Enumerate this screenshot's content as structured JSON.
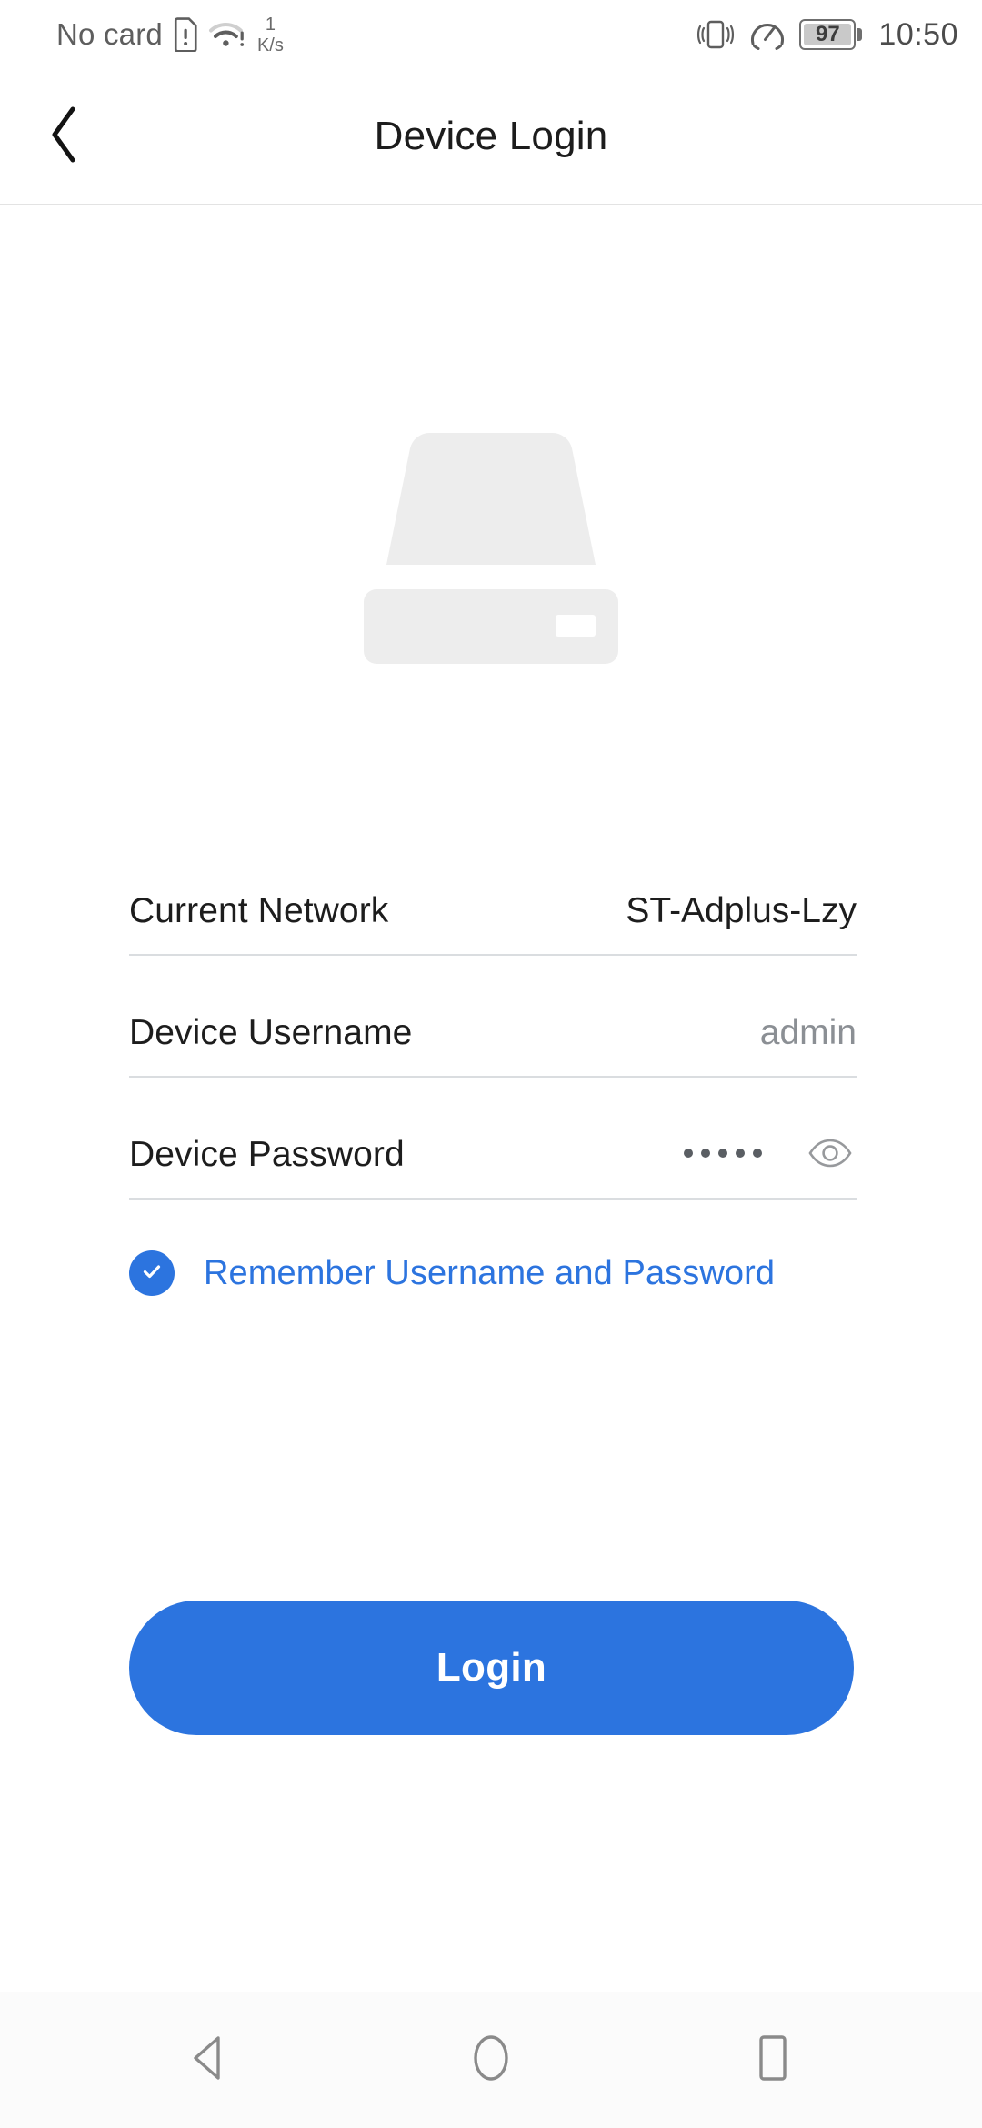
{
  "status_bar": {
    "carrier_text": "No card",
    "sim_icon": "sim-card-alert-icon",
    "wifi_icon": "wifi-warning-icon",
    "network_speed_value": "1",
    "network_speed_unit": "K/s",
    "vibrate_icon": "vibrate-icon",
    "data_saver_icon": "speedometer-icon",
    "battery_level": "97",
    "battery_icon": "battery-icon",
    "time": "10:50"
  },
  "app_bar": {
    "back_icon": "chevron-left-icon",
    "title": "Device Login"
  },
  "illustration": {
    "icon": "network-device-icon",
    "body_color": "#ededed",
    "led_color": "#ffffff"
  },
  "form": {
    "fields": [
      {
        "label": "Current Network",
        "value": "ST-Adplus-Lzy",
        "muted": false,
        "type": "readonly"
      },
      {
        "label": "Device Username",
        "value": "admin",
        "muted": true,
        "type": "text"
      },
      {
        "label": "Device Password",
        "value": "•••••",
        "masked_char_count": "5",
        "muted": false,
        "type": "password",
        "toggle_icon": "eye-icon"
      }
    ]
  },
  "remember": {
    "checked": "true",
    "check_icon": "checkmark-icon",
    "label": "Remember Username and Password"
  },
  "login": {
    "label": "Login"
  },
  "nav_bar": {
    "back_icon": "triangle-back-icon",
    "home_icon": "circle-home-icon",
    "recents_icon": "square-recents-icon"
  },
  "colors": {
    "accent": "#2c74df",
    "text_primary": "#1d1d1d",
    "text_muted": "#8b8f94",
    "divider": "#dadde0",
    "illustration": "#ededed"
  }
}
